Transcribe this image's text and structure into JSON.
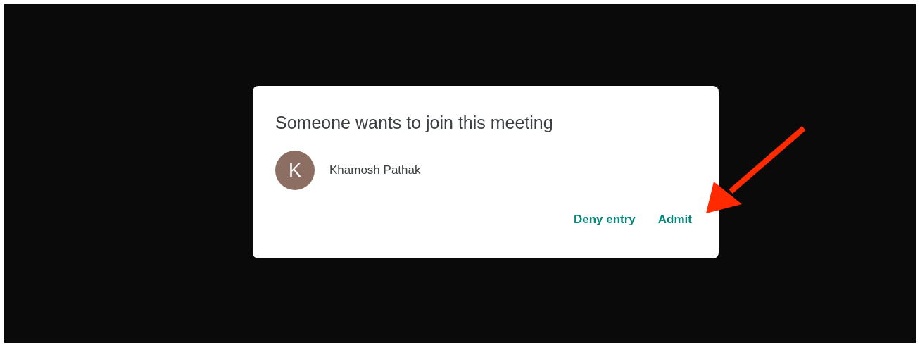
{
  "dialog": {
    "title": "Someone wants to join this meeting",
    "requester": {
      "initial": "K",
      "name": "Khamosh Pathak"
    },
    "buttons": [
      {
        "label": "Deny entry"
      },
      {
        "label": "Admit"
      }
    ]
  }
}
